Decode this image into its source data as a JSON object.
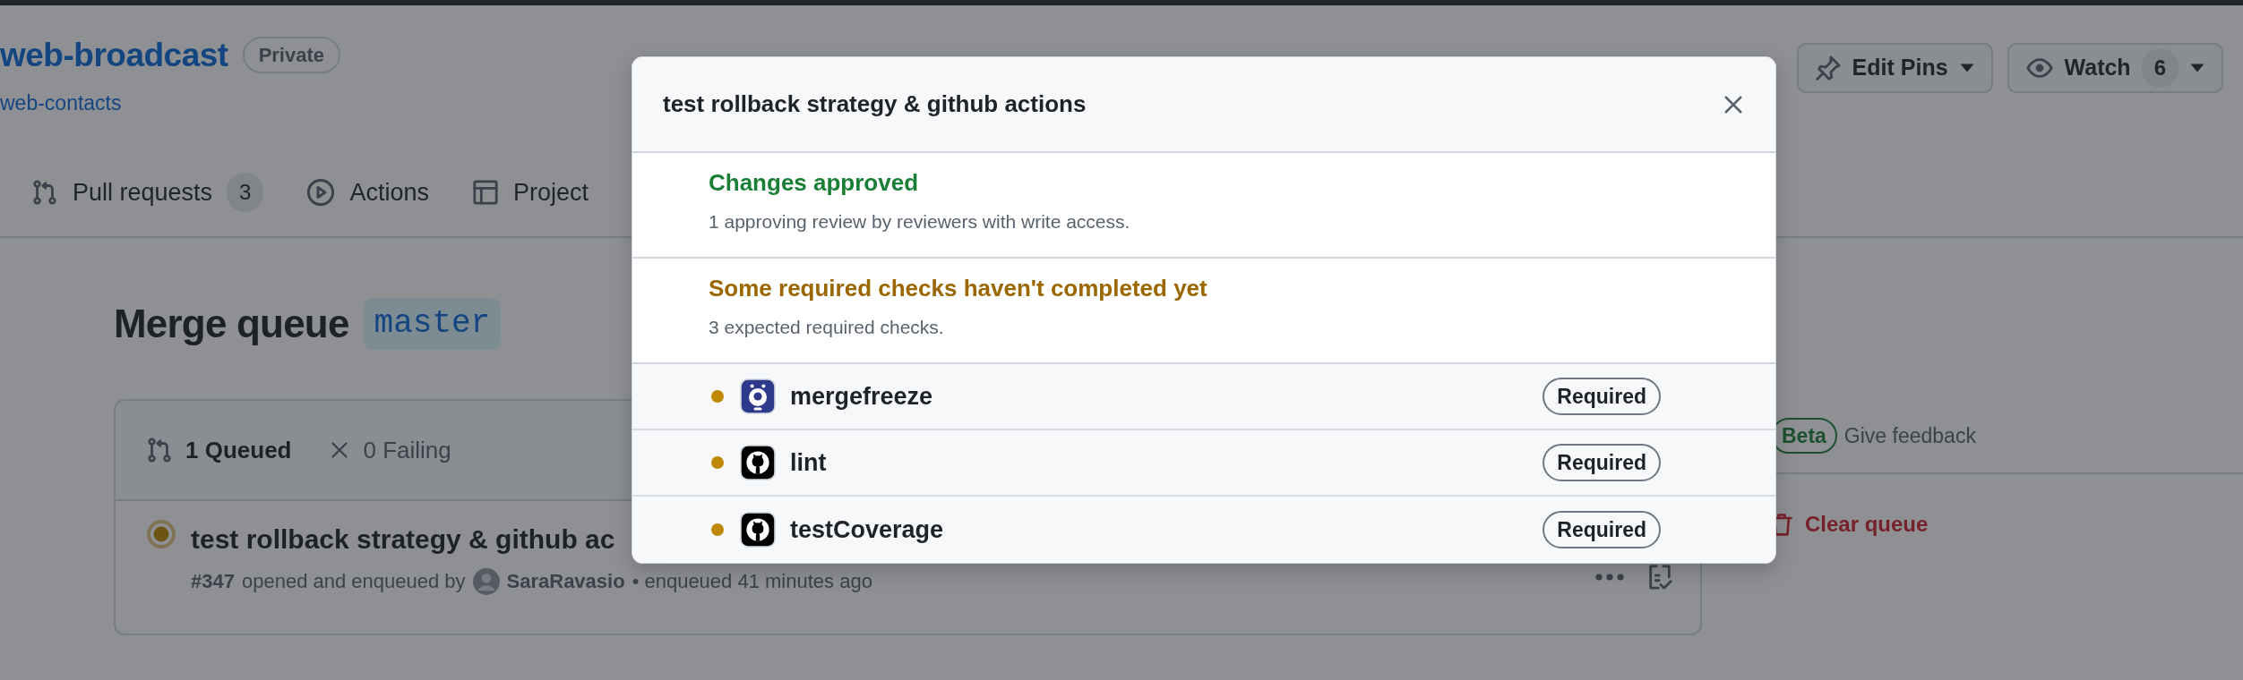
{
  "repo": {
    "name": "web-broadcast",
    "visibility": "Private",
    "parent": "web-contacts"
  },
  "header_buttons": [
    {
      "label": "Edit Pins",
      "kind": "pin"
    },
    {
      "label": "Watch",
      "count": "6",
      "kind": "watch"
    }
  ],
  "nav_tabs": [
    {
      "label": "Pull requests",
      "count": "3",
      "kind": "pulls"
    },
    {
      "label": "Actions",
      "kind": "actions"
    },
    {
      "label": "Project",
      "kind": "projects"
    }
  ],
  "merge_queue": {
    "title": "Merge queue",
    "branch": "master",
    "tabs": [
      {
        "label": "1 Queued",
        "kind": "queued",
        "selected": true
      },
      {
        "label": "0 Failing",
        "kind": "failing",
        "selected": false
      }
    ],
    "entries": [
      {
        "title": "test rollback strategy & github ac",
        "number": "#347",
        "meta": "opened and enqueued by",
        "author": "SaraRavasio",
        "time": "• enqueued 41 minutes ago"
      }
    ]
  },
  "sidebar": {
    "beta": "Beta",
    "feedback": "Give feedback",
    "clear": "Clear queue"
  },
  "dialog": {
    "title": "test rollback strategy & github actions",
    "sections": [
      {
        "kind": "approved",
        "title": "Changes approved",
        "description": "1 approving review by reviewers with write access."
      },
      {
        "kind": "pending",
        "title": "Some required checks haven't completed yet",
        "description": "3 expected required checks."
      }
    ],
    "checks": [
      {
        "name": "mergefreeze",
        "kind": "mergefreeze",
        "color": "#bf8700",
        "badge": "Required"
      },
      {
        "name": "lint",
        "kind": "github",
        "color": "#bf8700",
        "badge": "Required"
      },
      {
        "name": "testCoverage",
        "kind": "github",
        "color": "#bf8700",
        "badge": "Required"
      }
    ]
  }
}
